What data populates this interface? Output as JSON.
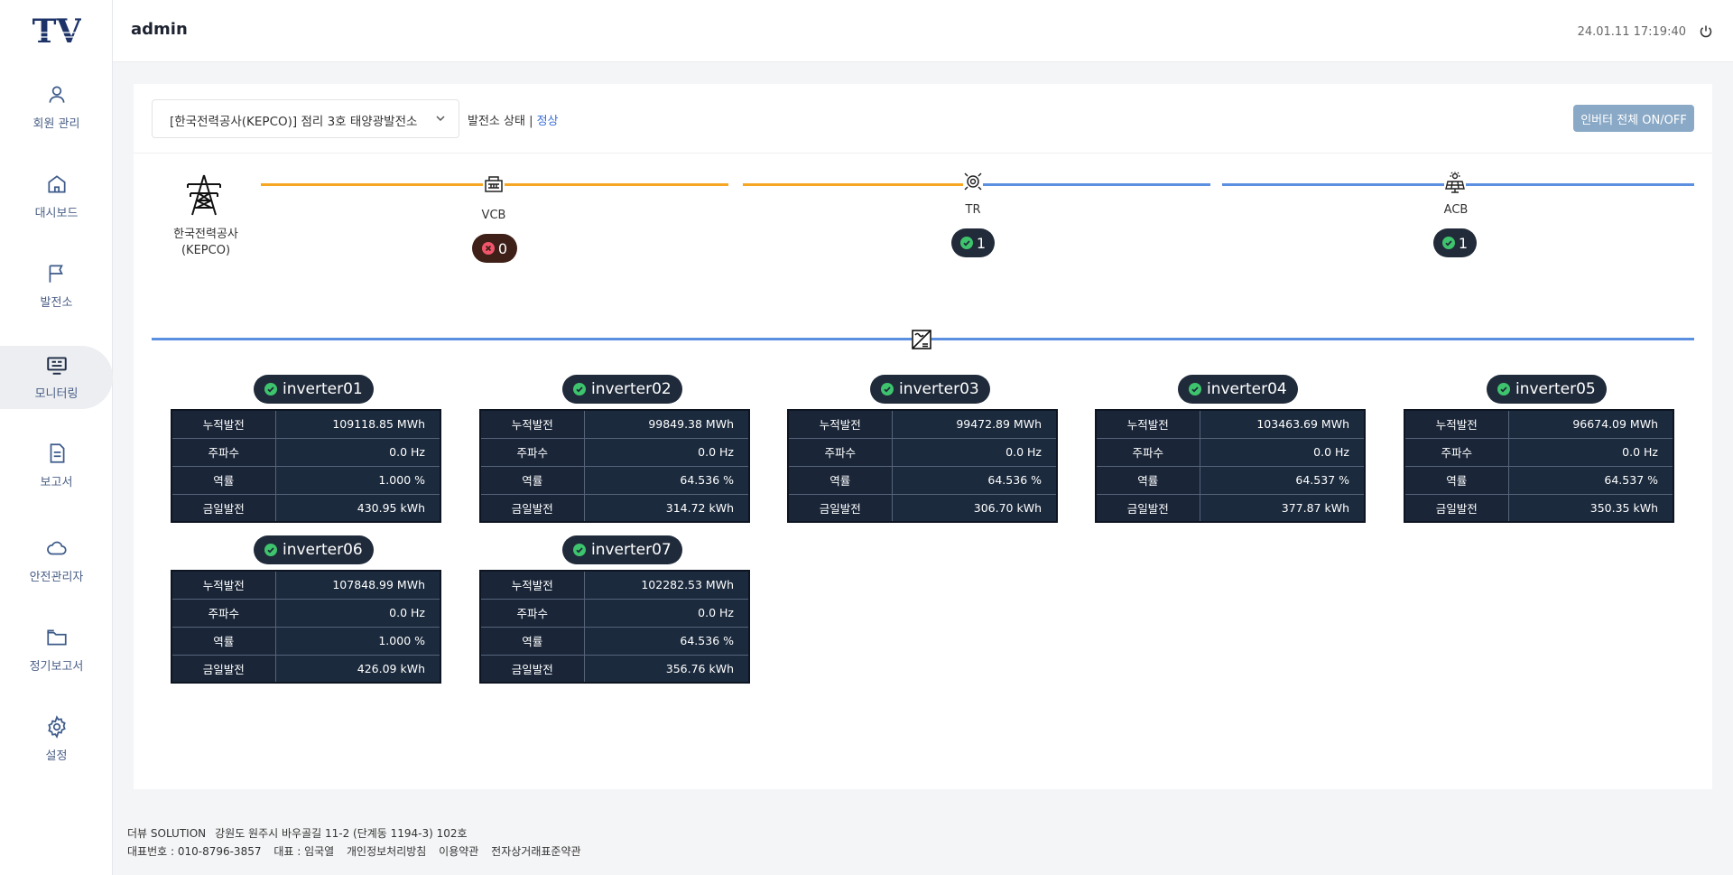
{
  "app": {
    "logo_text": "TV",
    "user_name": "admin",
    "datetime": "24.01.11 17:19:40"
  },
  "sidebar": {
    "items": [
      {
        "label": "회원 관리",
        "icon": "user-icon"
      },
      {
        "label": "대시보드",
        "icon": "home-icon"
      },
      {
        "label": "발전소",
        "icon": "flag-icon"
      },
      {
        "label": "모니터링",
        "icon": "monitor-icon",
        "active": true
      },
      {
        "label": "보고서",
        "icon": "document-icon"
      },
      {
        "label": "안전관리자",
        "icon": "cloud-icon"
      },
      {
        "label": "정기보고서",
        "icon": "folder-icon"
      },
      {
        "label": "설정",
        "icon": "gear-icon"
      }
    ]
  },
  "toolbar": {
    "plant_select_value": "[한국전력공사(KEPCO)] 점리 3호 태양광발전소",
    "status_label": "발전소 상태 | ",
    "status_value": "정상",
    "inverter_toggle_label": "인버터 전체 ON/OFF"
  },
  "diagram": {
    "source_label_line1": "한국전력공사",
    "source_label_line2": "(KEPCO)",
    "vcb": {
      "label": "VCB",
      "count": "0",
      "status": "error"
    },
    "tr": {
      "label": "TR",
      "count": "1",
      "status": "ok"
    },
    "acb": {
      "label": "ACB",
      "count": "1",
      "status": "ok"
    },
    "colors": {
      "active_line": "#f5a623",
      "idle_line": "#5b8fe0",
      "ok": "#3ec46d",
      "error": "#f2556b"
    }
  },
  "inverters": [
    {
      "name": "inverter01",
      "rows": [
        [
          "누적발전",
          "109118.85 MWh"
        ],
        [
          "주파수",
          "0.0 Hz"
        ],
        [
          "역률",
          "1.000 %"
        ],
        [
          "금일발전",
          "430.95 kWh"
        ]
      ]
    },
    {
      "name": "inverter02",
      "rows": [
        [
          "누적발전",
          "99849.38 MWh"
        ],
        [
          "주파수",
          "0.0 Hz"
        ],
        [
          "역률",
          "64.536 %"
        ],
        [
          "금일발전",
          "314.72 kWh"
        ]
      ]
    },
    {
      "name": "inverter03",
      "rows": [
        [
          "누적발전",
          "99472.89 MWh"
        ],
        [
          "주파수",
          "0.0 Hz"
        ],
        [
          "역률",
          "64.536 %"
        ],
        [
          "금일발전",
          "306.70 kWh"
        ]
      ]
    },
    {
      "name": "inverter04",
      "rows": [
        [
          "누적발전",
          "103463.69 MWh"
        ],
        [
          "주파수",
          "0.0 Hz"
        ],
        [
          "역률",
          "64.537 %"
        ],
        [
          "금일발전",
          "377.87 kWh"
        ]
      ]
    },
    {
      "name": "inverter05",
      "rows": [
        [
          "누적발전",
          "96674.09 MWh"
        ],
        [
          "주파수",
          "0.0 Hz"
        ],
        [
          "역률",
          "64.537 %"
        ],
        [
          "금일발전",
          "350.35 kWh"
        ]
      ]
    },
    {
      "name": "inverter06",
      "rows": [
        [
          "누적발전",
          "107848.99 MWh"
        ],
        [
          "주파수",
          "0.0 Hz"
        ],
        [
          "역률",
          "1.000 %"
        ],
        [
          "금일발전",
          "426.09 kWh"
        ]
      ]
    },
    {
      "name": "inverter07",
      "rows": [
        [
          "누적발전",
          "102282.53 MWh"
        ],
        [
          "주파수",
          "0.0 Hz"
        ],
        [
          "역률",
          "64.536 %"
        ],
        [
          "금일발전",
          "356.76 kWh"
        ]
      ]
    }
  ],
  "footer": {
    "company": "더뷰 SOLUTION",
    "address": "강원도 원주시 바우골길 11-2 (단계동 1194-3) 102호",
    "phone": "대표번호 : 010-8796-3857",
    "ceo": "대표 : 임국열",
    "links": [
      "개인정보처리방침",
      "이용약관",
      "전자상거래표준약관"
    ]
  }
}
